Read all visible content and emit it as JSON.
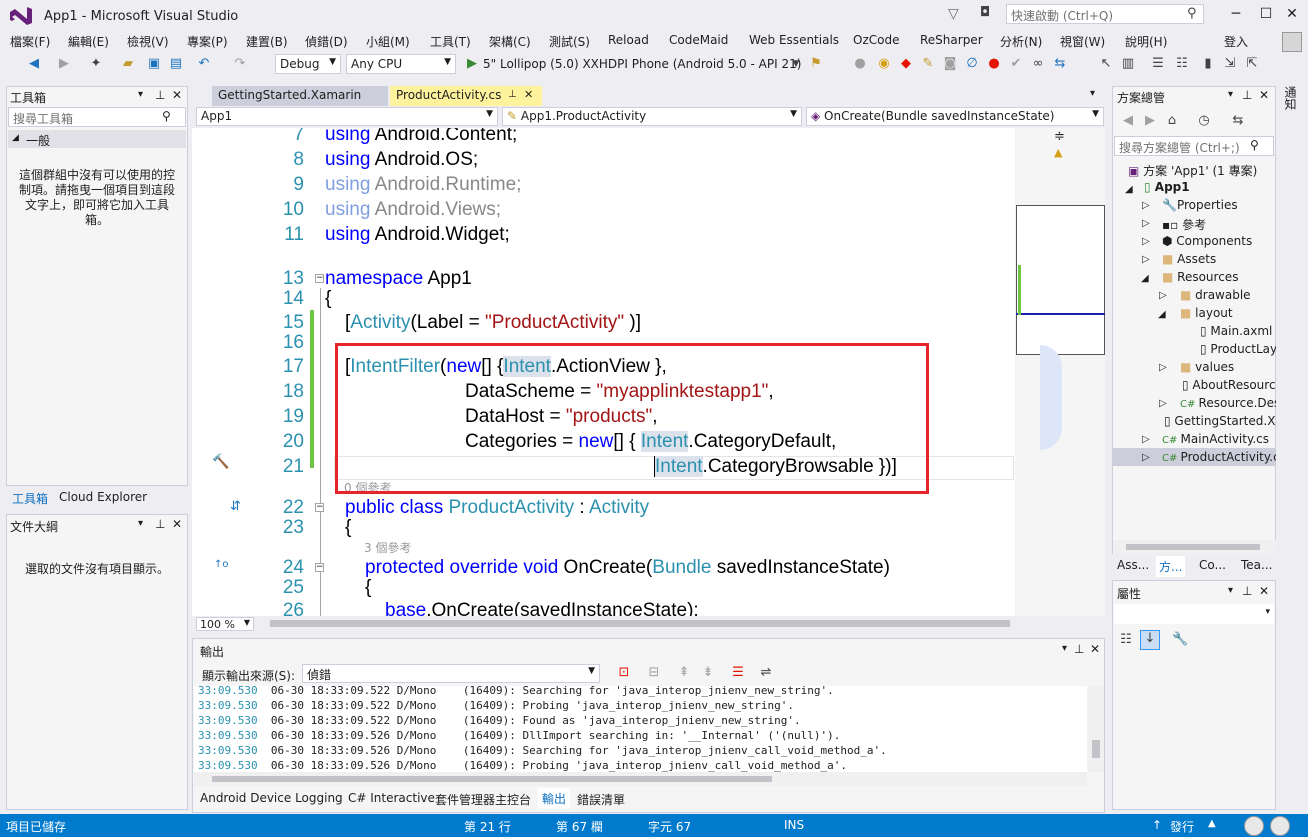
{
  "window": {
    "title": "App1 - Microsoft Visual Studio",
    "quick_launch": "快速啟動 (Ctrl+Q)",
    "sign_in": "登入",
    "minimize": "─",
    "maximize": "☐",
    "close": "✕"
  },
  "menu": [
    "檔案(F)",
    "編輯(E)",
    "檢視(V)",
    "專案(P)",
    "建置(B)",
    "偵錯(D)",
    "小組(M)",
    "工具(T)",
    "架構(C)",
    "測試(S)",
    "Reload",
    "CodeMaid",
    "Web Essentials",
    "OzCode",
    "ReSharper",
    "分析(N)",
    "視窗(W)",
    "說明(H)"
  ],
  "toolbar": {
    "config": "Debug",
    "platform": "Any CPU",
    "run_target": "5\" Lollipop (5.0) XXHDPI Phone (Android 5.0 - API 21)"
  },
  "toolbox": {
    "title": "工具箱",
    "search_placeholder": "搜尋工具箱",
    "group": "一般",
    "empty_msg": "這個群組中沒有可以使用的控制項。請拖曳一個項目到這段文字上，即可將它加入工具箱。",
    "tab_toolbox": "工具箱",
    "tab_cloud": "Cloud Explorer"
  },
  "doc_outline": {
    "title": "文件大綱",
    "empty_msg": "選取的文件沒有項目顯示。"
  },
  "editor": {
    "tabs": [
      {
        "label": "GettingStarted.Xamarin",
        "active": false
      },
      {
        "label": "ProductActivity.cs",
        "active": true
      }
    ],
    "nav": {
      "project": "App1",
      "class": "App1.ProductActivity",
      "member": "OnCreate(Bundle savedInstanceState)"
    },
    "zoom": "100 %",
    "refs_0": "0 個參考",
    "refs_3": "3 個參考",
    "lines": {
      "l7": "7",
      "l8": "8",
      "l9": "9",
      "l10": "10",
      "l11": "11",
      "l13": "13",
      "l14": "14",
      "l15": "15",
      "l16": "16",
      "l17": "17",
      "l18": "18",
      "l19": "19",
      "l20": "20",
      "l21": "21",
      "l22": "22",
      "l23": "23",
      "l24": "24",
      "l25": "25",
      "l26": "26"
    },
    "code": {
      "using": "using",
      "ns7": "Android.Content;",
      "ns8": "Android.OS;",
      "ns9": "Android.Runtime;",
      "ns10": "Android.Views;",
      "ns11": "Android.Widget;",
      "namespace_kw": "namespace",
      "namespace_name": "App1",
      "brace_open": "{",
      "attr_activity": "Activity",
      "attr_label": "(Label = ",
      "attr_label_val": "\"ProductActivity\"",
      "attr_close": " )]",
      "bracket": "[",
      "intentfilter": "IntentFilter",
      "paren_open": "(",
      "new_kw": "new",
      "arr_open": "[] {",
      "intent": "Intent",
      "action_view": ".ActionView },",
      "data_scheme": "DataScheme = ",
      "data_scheme_val": "\"myapplinktestapp1\"",
      "comma": ",",
      "data_host": "DataHost = ",
      "data_host_val": "\"products\"",
      "categories": "Categories = ",
      "arr_open2": "[] { ",
      "cat_default": ".CategoryDefault,",
      "cat_browsable": ".CategoryBrowsable })]",
      "public_class": "public class",
      "class_name": "ProductActivity",
      "colon": " : ",
      "base_type": "Activity",
      "protected_override_void": "protected override void",
      "method": " OnCreate(",
      "bundle": "Bundle",
      "param": " savedInstanceState)",
      "base_kw": "base",
      "base_call": ".OnCreate(savedInstanceState);"
    }
  },
  "output": {
    "title": "輸出",
    "source_label": "顯示輸出來源(S):",
    "source_value": "偵錯",
    "lines": [
      {
        "t": "33:09.530",
        "msg": "06-30 18:33:09.522 D/Mono    (16409): Searching for 'java_interop_jnienv_new_string'."
      },
      {
        "t": "33:09.530",
        "msg": "06-30 18:33:09.522 D/Mono    (16409): Probing 'java_interop_jnienv_new_string'."
      },
      {
        "t": "33:09.530",
        "msg": "06-30 18:33:09.522 D/Mono    (16409): Found as 'java_interop_jnienv_new_string'."
      },
      {
        "t": "33:09.530",
        "msg": "06-30 18:33:09.526 D/Mono    (16409): DllImport searching in: '__Internal' ('(null)')."
      },
      {
        "t": "33:09.530",
        "msg": "06-30 18:33:09.526 D/Mono    (16409): Searching for 'java_interop_jnienv_call_void_method_a'."
      },
      {
        "t": "33:09.530",
        "msg": "06-30 18:33:09.526 D/Mono    (16409): Probing 'java_interop_jnienv_call_void_method_a'."
      }
    ],
    "bottom_tabs": [
      "Android Device Logging",
      "C# Interactive",
      "套件管理器主控台",
      "輸出",
      "錯誤清單"
    ]
  },
  "solution": {
    "title": "方案總管",
    "search_placeholder": "搜尋方案總管 (Ctrl+;)",
    "items": [
      "方案 'App1' (1 專案)",
      "App1",
      "Properties",
      "參考",
      "Components",
      "Assets",
      "Resources",
      "drawable",
      "layout",
      "Main.axml",
      "ProductLayout",
      "values",
      "AboutResources",
      "Resource.Designer",
      "GettingStarted.Xamarin",
      "MainActivity.cs",
      "ProductActivity.cs"
    ],
    "tabs": [
      "Ass...",
      "方...",
      "Co...",
      "Tea..."
    ]
  },
  "properties": {
    "title": "屬性"
  },
  "right_strip": "通知",
  "status": {
    "ready": "項目已儲存",
    "line": "第 21 行",
    "col": "第 67 欄",
    "char": "字元 67",
    "ins": "INS",
    "publish": "發行"
  }
}
